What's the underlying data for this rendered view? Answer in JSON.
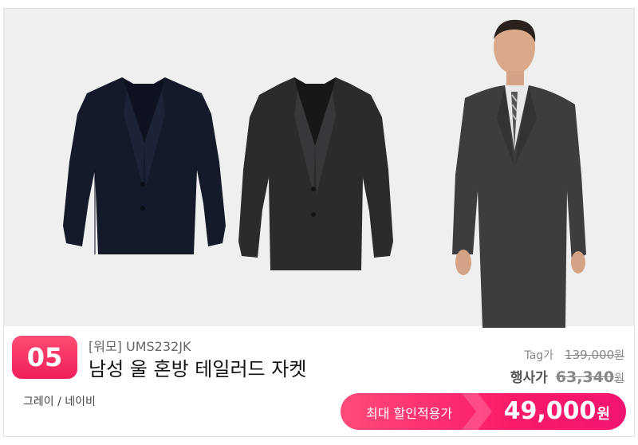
{
  "product": {
    "rank": "05",
    "brand_code": "[워모] UMS232JK",
    "name": "남성 울 혼방 테일러드 자켓",
    "colors": "그레이 / 네이비",
    "image_alts": [
      "navy-jacket",
      "gray-jacket",
      "model-wearing-gray-suit"
    ]
  },
  "pricing": {
    "tag_label": "Tag가",
    "tag_price": "139,000",
    "event_label": "행사가",
    "event_price": "63,340",
    "currency": "원",
    "discount_label": "최대 할인적용가",
    "final_price": "49,000"
  },
  "colors": {
    "accent": "#f5236a",
    "badge": "#f53566",
    "image_bg": "#efefef"
  }
}
